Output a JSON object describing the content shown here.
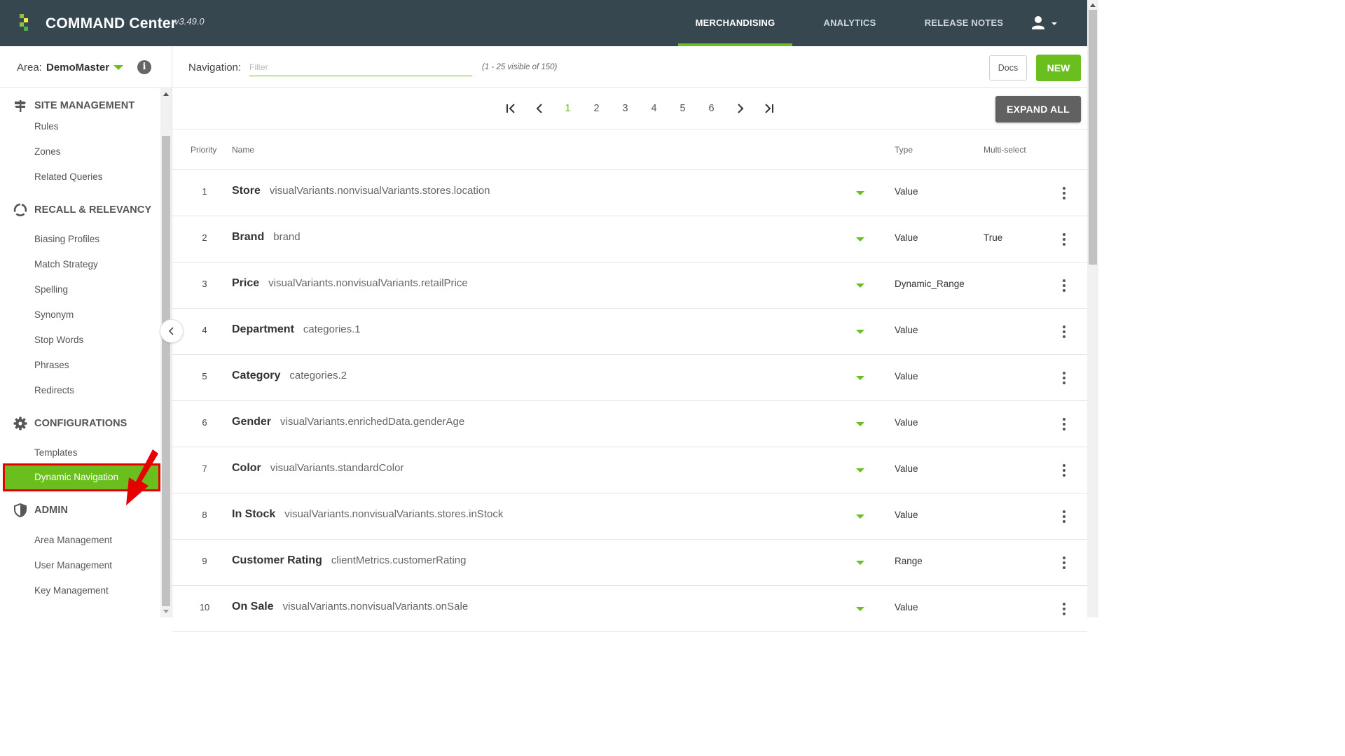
{
  "header": {
    "app_title": "COMMAND Center",
    "version": "v3.49.0",
    "tabs": [
      {
        "label": "MERCHANDISING",
        "active": true
      },
      {
        "label": "ANALYTICS",
        "active": false
      },
      {
        "label": "RELEASE NOTES",
        "active": false
      }
    ],
    "user_icon": "account-icon"
  },
  "sidebar": {
    "area_label": "Area:",
    "area_value": "DemoMaster",
    "info_icon": "i",
    "sections": [
      {
        "title": "SITE MANAGEMENT",
        "icon": "signpost-icon",
        "items": [
          "Rules",
          "Zones",
          "Related Queries"
        ]
      },
      {
        "title": "RECALL & RELEVANCY",
        "icon": "circular-arrows-icon",
        "items": [
          "Biasing Profiles",
          "Match Strategy",
          "Spelling",
          "Synonym",
          "Stop Words",
          "Phrases",
          "Redirects"
        ]
      },
      {
        "title": "CONFIGURATIONS",
        "icon": "gear-icon",
        "items": [
          "Templates",
          "Dynamic Navigation"
        ]
      },
      {
        "title": "ADMIN",
        "icon": "shield-icon",
        "items": [
          "Area Management",
          "User Management",
          "Key Management"
        ]
      }
    ],
    "active_item": "Dynamic Navigation",
    "accent_color": "#6abf1e",
    "annotation_color": "#e60000"
  },
  "toolbar": {
    "navigation_label": "Navigation:",
    "filter_placeholder": "Filter",
    "filter_value": "",
    "count_text": "(1 - 25 visible of 150)",
    "docs_label": "Docs",
    "new_label": "NEW"
  },
  "pagination": {
    "pages": [
      "1",
      "2",
      "3",
      "4",
      "5",
      "6"
    ],
    "current": "1",
    "expand_all_label": "EXPAND ALL"
  },
  "table": {
    "headers": {
      "priority": "Priority",
      "name": "Name",
      "type": "Type",
      "multi_select": "Multi-select"
    },
    "rows": [
      {
        "priority": "1",
        "name": "Store",
        "field": "visualVariants.nonvisualVariants.stores.location",
        "type": "Value",
        "multi_select": ""
      },
      {
        "priority": "2",
        "name": "Brand",
        "field": "brand",
        "type": "Value",
        "multi_select": "True"
      },
      {
        "priority": "3",
        "name": "Price",
        "field": "visualVariants.nonvisualVariants.retailPrice",
        "type": "Dynamic_Range",
        "multi_select": ""
      },
      {
        "priority": "4",
        "name": "Department",
        "field": "categories.1",
        "type": "Value",
        "multi_select": ""
      },
      {
        "priority": "5",
        "name": "Category",
        "field": "categories.2",
        "type": "Value",
        "multi_select": ""
      },
      {
        "priority": "6",
        "name": "Gender",
        "field": "visualVariants.enrichedData.genderAge",
        "type": "Value",
        "multi_select": ""
      },
      {
        "priority": "7",
        "name": "Color",
        "field": "visualVariants.standardColor",
        "type": "Value",
        "multi_select": ""
      },
      {
        "priority": "8",
        "name": "In Stock",
        "field": "visualVariants.nonvisualVariants.stores.inStock",
        "type": "Value",
        "multi_select": ""
      },
      {
        "priority": "9",
        "name": "Customer Rating",
        "field": "clientMetrics.customerRating",
        "type": "Range",
        "multi_select": ""
      },
      {
        "priority": "10",
        "name": "On Sale",
        "field": "visualVariants.nonvisualVariants.onSale",
        "type": "Value",
        "multi_select": ""
      }
    ]
  }
}
